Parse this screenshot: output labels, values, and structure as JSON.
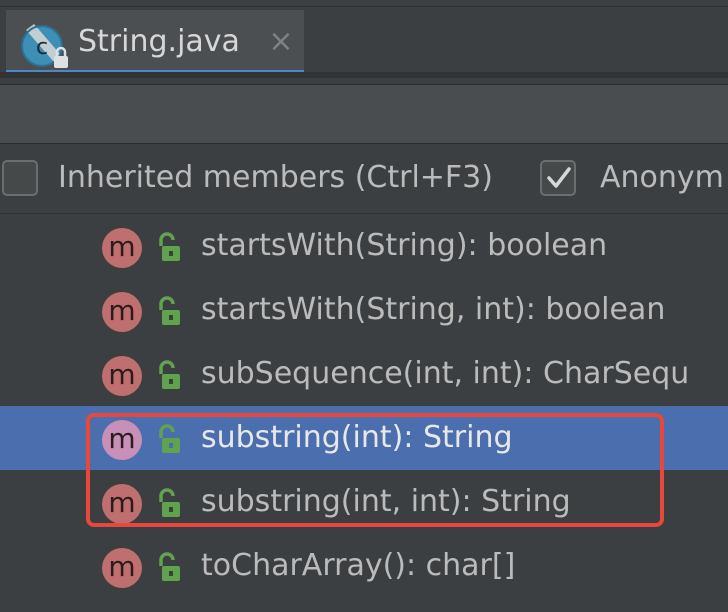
{
  "tab": {
    "file_name": "String.java",
    "close_glyph": "×",
    "icon_letter": "c",
    "icon": "class-file-icon"
  },
  "options": {
    "inherited_members": {
      "label": "Inherited members (Ctrl+F3)",
      "checked": false
    },
    "anonymous_classes": {
      "label": "Anonym",
      "checked": true
    }
  },
  "members": [
    {
      "icon_letter": "m",
      "label": "startsWith(String): boolean",
      "selected": false
    },
    {
      "icon_letter": "m",
      "label": "startsWith(String, int): boolean",
      "selected": false
    },
    {
      "icon_letter": "m",
      "label": "subSequence(int, int): CharSequ",
      "selected": false
    },
    {
      "icon_letter": "m",
      "label": "substring(int): String",
      "selected": true
    },
    {
      "icon_letter": "m",
      "label": "substring(int, int): String",
      "selected": false
    },
    {
      "icon_letter": "m",
      "label": "toCharArray(): char[]",
      "selected": false
    }
  ],
  "colors": {
    "background": "#3c3f41",
    "selection": "#4b6eaf",
    "method_icon": "#bf6f6f",
    "public_lock": "#5fa34f",
    "highlight_border": "#e8473c",
    "tab_accent": "#4a88c7"
  }
}
